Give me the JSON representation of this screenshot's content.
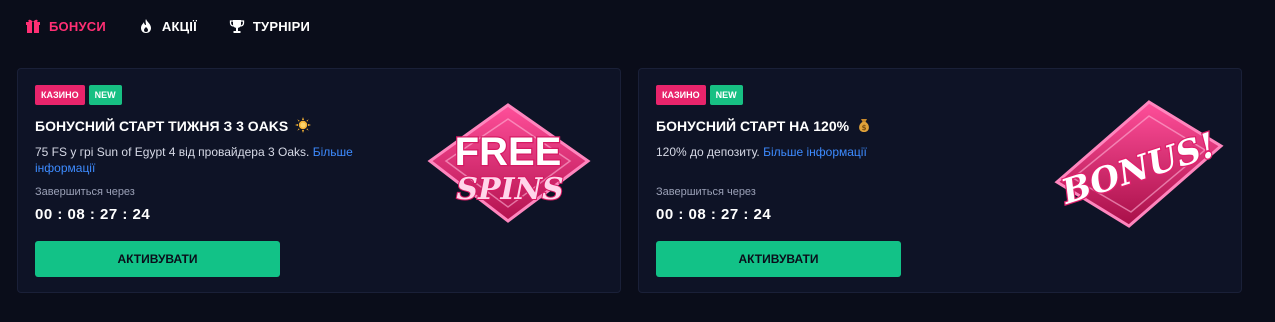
{
  "tabs": [
    {
      "label": "БОНУСИ",
      "icon": "gift-icon",
      "active": true
    },
    {
      "label": "АКЦІЇ",
      "icon": "fire-icon",
      "active": false
    },
    {
      "label": "ТУРНІРИ",
      "icon": "trophy-icon",
      "active": false
    }
  ],
  "colors": {
    "accent": "#ff2f74",
    "casino_badge": "#e8246b",
    "new_badge": "#17c083",
    "button": "#12c287",
    "link": "#3d8bff"
  },
  "cards": [
    {
      "badges": [
        "КАЗИНО",
        "NEW"
      ],
      "title": "БОНУСНИЙ СТАРТ ТИЖНЯ З 3 OAKS",
      "title_icon": "sun-icon",
      "description": "75 FS у грі Sun of Egypt 4 від провайдера 3 Oaks.",
      "more_link": "Більше інформації",
      "ends_label": "Завершиться через",
      "timer": "00 : 08 : 27 : 24",
      "button_label": "АКТИВУВАТИ",
      "art": {
        "line1": "FREE",
        "line2": "SPINS",
        "icon": "free-spins-logo-icon"
      }
    },
    {
      "badges": [
        "КАЗИНО",
        "NEW"
      ],
      "title": "БОНУСНИЙ СТАРТ НА 120%",
      "title_icon": "money-bag-icon",
      "description": "120% до депозиту.",
      "more_link": "Більше інформації",
      "ends_label": "Завершиться через",
      "timer": "00 : 08 : 27 : 24",
      "button_label": "АКТИВУВАТИ",
      "art": {
        "text": "BONUS!",
        "icon": "bonus-logo-icon"
      }
    }
  ]
}
